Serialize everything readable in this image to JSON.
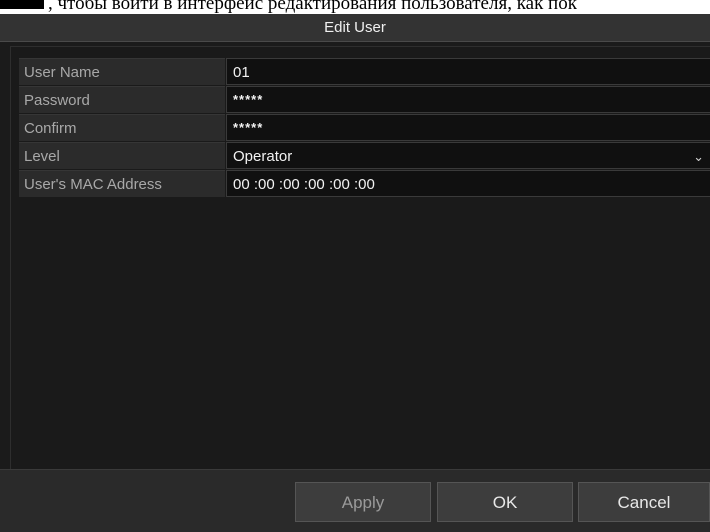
{
  "doc_caption": ", чтобы войти в интерфейс редактирования пользователя, как пок",
  "dialog": {
    "title": "Edit User"
  },
  "form": {
    "user_name_label": "User Name",
    "user_name_value": "01",
    "password_label": "Password",
    "password_value": "*****",
    "confirm_label": "Confirm",
    "confirm_value": "*****",
    "level_label": "Level",
    "level_value": "Operator",
    "mac_label": "User's MAC Address",
    "mac_octets": [
      "00",
      "00",
      "00",
      "00",
      "00",
      "00"
    ],
    "mac_separator": ":"
  },
  "footer": {
    "apply_label": "Apply",
    "ok_label": "OK",
    "cancel_label": "Cancel"
  },
  "icons": {
    "level_dropdown": "chevron-down-icon"
  },
  "colors": {
    "background": "#1b1b1b",
    "title_bar": "#333333",
    "label_cell": "#2b2b2b",
    "value_cell": "#101010"
  }
}
